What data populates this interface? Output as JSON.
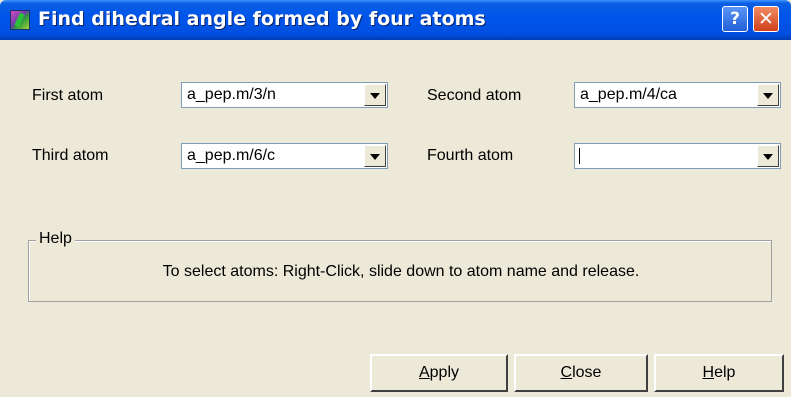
{
  "window": {
    "title": "Find dihedral angle formed by four atoms"
  },
  "titlebar": {
    "help_glyph": "?",
    "close_glyph": "✕"
  },
  "form": {
    "first_atom": {
      "label": "First atom",
      "value": "a_pep.m/3/n"
    },
    "second_atom": {
      "label": "Second atom",
      "value": "a_pep.m/4/ca"
    },
    "third_atom": {
      "label": "Third atom",
      "value": "a_pep.m/6/c"
    },
    "fourth_atom": {
      "label": "Fourth atom",
      "value": ""
    }
  },
  "help_group": {
    "label": "Help",
    "text": "To select atoms: Right-Click, slide down to atom name and release."
  },
  "buttons": {
    "apply": {
      "mnemonic": "A",
      "rest": "pply"
    },
    "close": {
      "mnemonic": "C",
      "rest": "lose"
    },
    "help": {
      "mnemonic": "H",
      "rest": "elp"
    }
  }
}
